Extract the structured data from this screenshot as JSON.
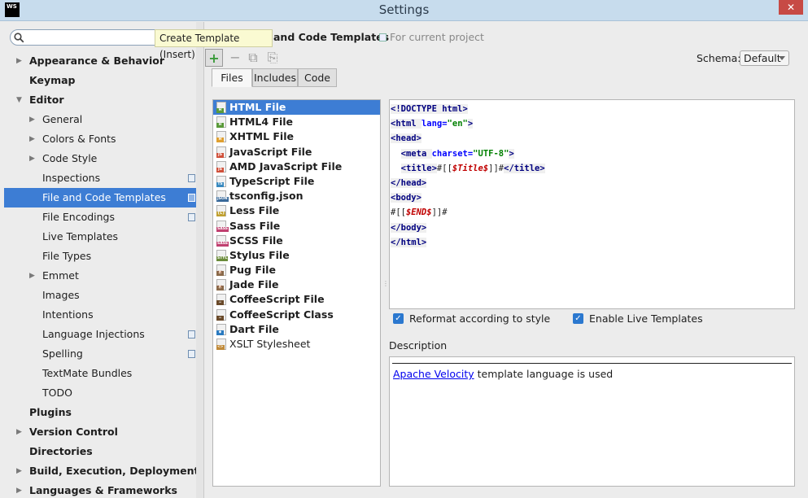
{
  "window": {
    "logo_text": "WS",
    "title": "Settings",
    "close_glyph": "✕"
  },
  "search": {
    "value": "",
    "placeholder": ""
  },
  "sidebar": {
    "items": [
      {
        "label": "Appearance & Behavior",
        "bold": true,
        "arrow": "▶",
        "indent": 0
      },
      {
        "label": "Keymap",
        "bold": true,
        "arrow": "",
        "indent": 0
      },
      {
        "label": "Editor",
        "bold": true,
        "arrow": "▼",
        "indent": 0
      },
      {
        "label": "General",
        "bold": false,
        "arrow": "▶",
        "indent": 1
      },
      {
        "label": "Colors & Fonts",
        "bold": false,
        "arrow": "▶",
        "indent": 1
      },
      {
        "label": "Code Style",
        "bold": false,
        "arrow": "▶",
        "indent": 1
      },
      {
        "label": "Inspections",
        "bold": false,
        "arrow": "",
        "indent": 1,
        "project": true
      },
      {
        "label": "File and Code Templates",
        "bold": false,
        "arrow": "",
        "indent": 1,
        "project": true,
        "selected": true
      },
      {
        "label": "File Encodings",
        "bold": false,
        "arrow": "",
        "indent": 1,
        "project": true
      },
      {
        "label": "Live Templates",
        "bold": false,
        "arrow": "",
        "indent": 1
      },
      {
        "label": "File Types",
        "bold": false,
        "arrow": "",
        "indent": 1
      },
      {
        "label": "Emmet",
        "bold": false,
        "arrow": "▶",
        "indent": 1
      },
      {
        "label": "Images",
        "bold": false,
        "arrow": "",
        "indent": 1
      },
      {
        "label": "Intentions",
        "bold": false,
        "arrow": "",
        "indent": 1
      },
      {
        "label": "Language Injections",
        "bold": false,
        "arrow": "",
        "indent": 1,
        "project": true
      },
      {
        "label": "Spelling",
        "bold": false,
        "arrow": "",
        "indent": 1,
        "project": true
      },
      {
        "label": "TextMate Bundles",
        "bold": false,
        "arrow": "",
        "indent": 1
      },
      {
        "label": "TODO",
        "bold": false,
        "arrow": "",
        "indent": 1
      },
      {
        "label": "Plugins",
        "bold": true,
        "arrow": "",
        "indent": 0
      },
      {
        "label": "Version Control",
        "bold": true,
        "arrow": "▶",
        "indent": 0
      },
      {
        "label": "Directories",
        "bold": true,
        "arrow": "",
        "indent": 0
      },
      {
        "label": "Build, Execution, Deployment",
        "bold": true,
        "arrow": "▶",
        "indent": 0
      },
      {
        "label": "Languages & Frameworks",
        "bold": true,
        "arrow": "▶",
        "indent": 0
      }
    ]
  },
  "header": {
    "title": "and Code Templates",
    "scope": "For current project"
  },
  "tooltip": {
    "text": "Create Template (Insert)"
  },
  "toolbar": {
    "add_glyph": "+",
    "remove_glyph": "−",
    "copy_glyph": "⧉",
    "reset_glyph": "⎘"
  },
  "schema": {
    "label": "Schema:",
    "value": "Default"
  },
  "tabs": [
    {
      "label": "Files",
      "active": true
    },
    {
      "label": "Includes",
      "active": false
    },
    {
      "label": "Code",
      "active": false
    }
  ],
  "templates": [
    {
      "label": "HTML File",
      "tag": "H",
      "color": "#5a9a3a",
      "selected": true
    },
    {
      "label": "HTML4 File",
      "tag": "H",
      "color": "#5a9a3a"
    },
    {
      "label": "XHTML File",
      "tag": "H",
      "color": "#e0a030"
    },
    {
      "label": "JavaScript File",
      "tag": "JS",
      "color": "#d0503a"
    },
    {
      "label": "AMD JavaScript File",
      "tag": "JS",
      "color": "#d0503a"
    },
    {
      "label": "TypeScript File",
      "tag": "TS",
      "color": "#3a8ac0"
    },
    {
      "label": "tsconfig.json",
      "tag": "JSON",
      "color": "#3a6a9a"
    },
    {
      "label": "Less File",
      "tag": "{L}",
      "color": "#c0a030"
    },
    {
      "label": "Sass File",
      "tag": "SASS",
      "color": "#c04070"
    },
    {
      "label": "SCSS File",
      "tag": "SASS",
      "color": "#c04070"
    },
    {
      "label": "Stylus File",
      "tag": "STYL",
      "color": "#6a8a3a"
    },
    {
      "label": "Pug File",
      "tag": "🐶",
      "color": "#8a6a4a"
    },
    {
      "label": "Jade File",
      "tag": "🐶",
      "color": "#8a6a4a"
    },
    {
      "label": "CoffeeScript File",
      "tag": "☕",
      "color": "#6a4a2a"
    },
    {
      "label": "CoffeeScript Class",
      "tag": "☕",
      "color": "#6a4a2a"
    },
    {
      "label": "Dart File",
      "tag": "◆",
      "color": "#2a7ac0"
    },
    {
      "label": "XSLT Stylesheet",
      "tag": "<>",
      "color": "#c08a3a",
      "plain": true
    }
  ],
  "editor": {
    "lines": [
      [
        {
          "t": "<!DOCTYPE ",
          "c": "tagc"
        },
        {
          "t": "html",
          "c": "tagc"
        },
        {
          "t": ">",
          "c": "tagc"
        }
      ],
      [
        {
          "t": "<html ",
          "c": "tagc"
        },
        {
          "t": "lang=",
          "c": "attr"
        },
        {
          "t": "\"en\"",
          "c": "str"
        },
        {
          "t": ">",
          "c": "tagc"
        }
      ],
      [
        {
          "t": "<head>",
          "c": "tagc"
        }
      ],
      [
        {
          "t": "  ",
          "c": ""
        },
        {
          "t": "<meta ",
          "c": "tagc"
        },
        {
          "t": "charset=",
          "c": "attr"
        },
        {
          "t": "\"UTF-8\"",
          "c": "str"
        },
        {
          "t": ">",
          "c": "tagc"
        }
      ],
      [
        {
          "t": "  ",
          "c": ""
        },
        {
          "t": "<title>",
          "c": "tagc"
        },
        {
          "t": "#[[",
          "c": ""
        },
        {
          "t": "$Title$",
          "c": "var"
        },
        {
          "t": "]]#",
          "c": ""
        },
        {
          "t": "</title>",
          "c": "tagc"
        }
      ],
      [
        {
          "t": "</head>",
          "c": "tagc"
        }
      ],
      [
        {
          "t": "<body>",
          "c": "tagc"
        }
      ],
      [
        {
          "t": "#[[",
          "c": ""
        },
        {
          "t": "$END$",
          "c": "var"
        },
        {
          "t": "]]#",
          "c": ""
        }
      ],
      [
        {
          "t": "</body>",
          "c": "tagc"
        }
      ],
      [
        {
          "t": "</html>",
          "c": "tagc"
        }
      ]
    ]
  },
  "options": {
    "reformat_label": "Reformat according to style",
    "reformat_checked": true,
    "live_templates_label": "Enable Live Templates",
    "live_templates_checked": true
  },
  "description": {
    "label": "Description",
    "link_text": "Apache Velocity",
    "text": " template language is used"
  },
  "colors": {
    "selection": "#3d7dd4",
    "titlebar": "#c7dced",
    "close": "#c74a45"
  }
}
